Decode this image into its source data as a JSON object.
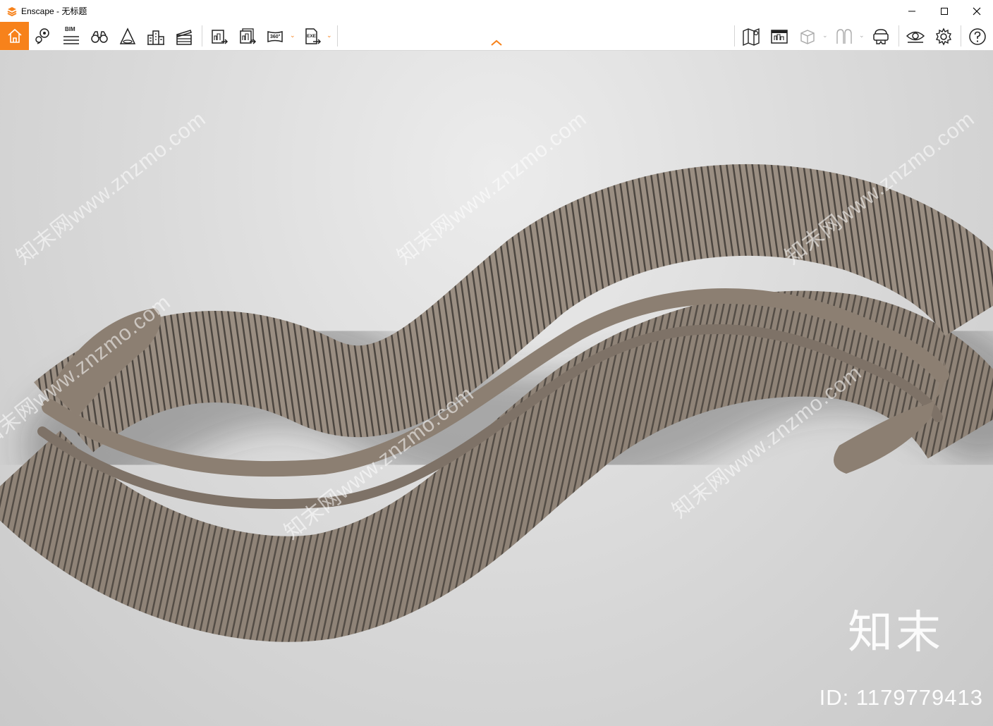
{
  "window": {
    "title": "Enscape - 无标题",
    "controls": [
      "minimize-icon",
      "maximize-icon",
      "close-icon"
    ]
  },
  "toolbar": {
    "bim_label": "BIM",
    "icons": [
      "home-icon",
      "location-pin-icon",
      "bim-icon",
      "binoculars-icon",
      "perspective-icon",
      "city-icon",
      "video-clapper-icon",
      "render-image-icon",
      "batch-render-icon",
      "panorama-360-icon",
      "export-exe-icon",
      "map-icon",
      "info-panel-icon",
      "cube-icon",
      "asset-library-icon",
      "vr-headset-icon",
      "visibility-eye-icon",
      "settings-gear-icon",
      "help-icon"
    ],
    "panorama_label": "360°",
    "exe_label": "EXE",
    "accent": "#f7821b"
  },
  "viewport": {
    "watermark_text": "知末网www.znzmo.com",
    "brand": "知末",
    "asset_id": "ID: 1179779413",
    "background": "#d8d8d8",
    "object_color": "#8c7f72"
  }
}
